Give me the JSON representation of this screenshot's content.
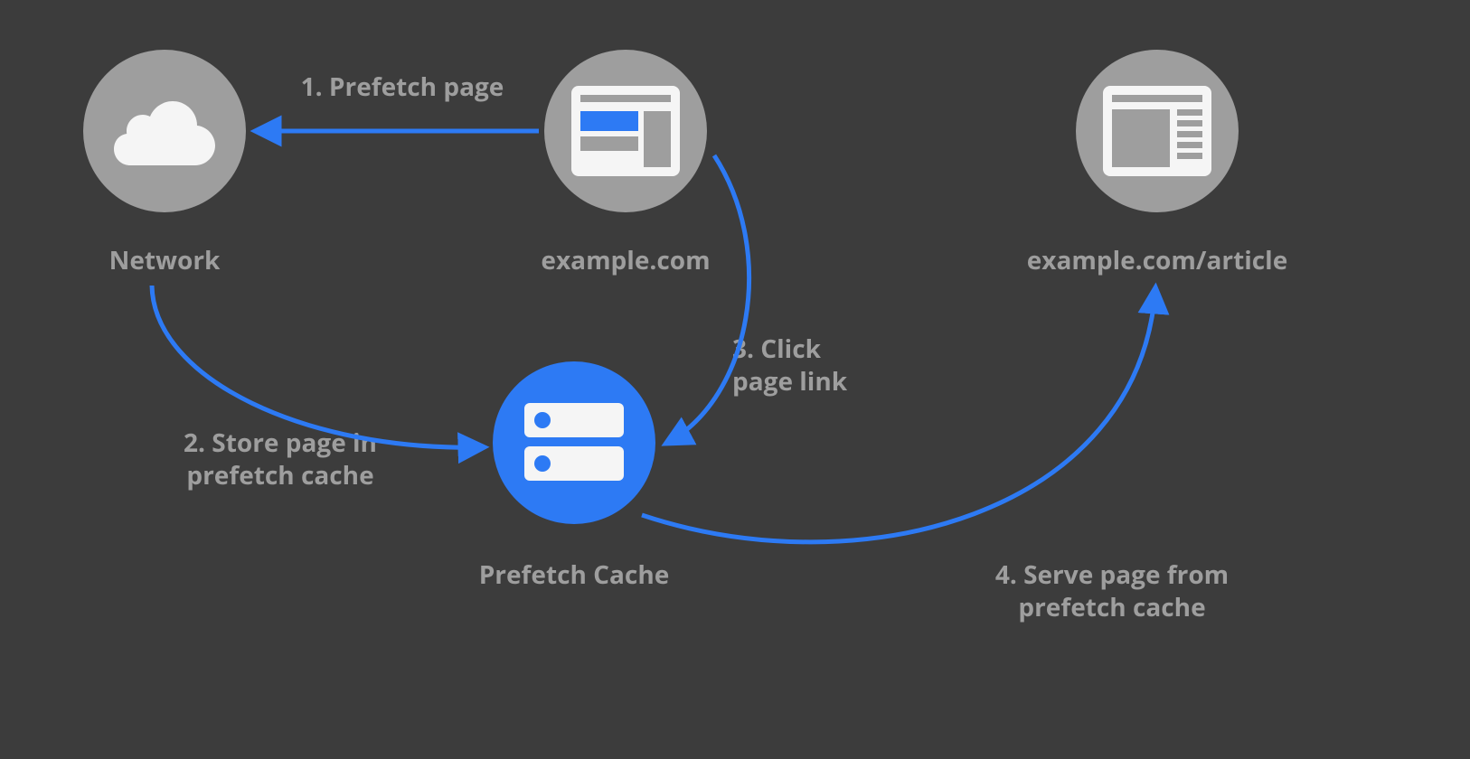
{
  "nodes": {
    "network": {
      "label": "Network"
    },
    "example": {
      "label": "example.com"
    },
    "cache": {
      "label": "Prefetch Cache"
    },
    "article": {
      "label": "example.com/article"
    }
  },
  "steps": {
    "s1": "1. Prefetch page",
    "s2": "2. Store page in\nprefetch cache",
    "s3": "3. Click\npage link",
    "s4": "4. Serve page from\nprefetch cache"
  },
  "colors": {
    "bg": "#3c3c3c",
    "gray": "#9e9e9e",
    "blue": "#2d7af4",
    "white": "#f5f5f5"
  }
}
